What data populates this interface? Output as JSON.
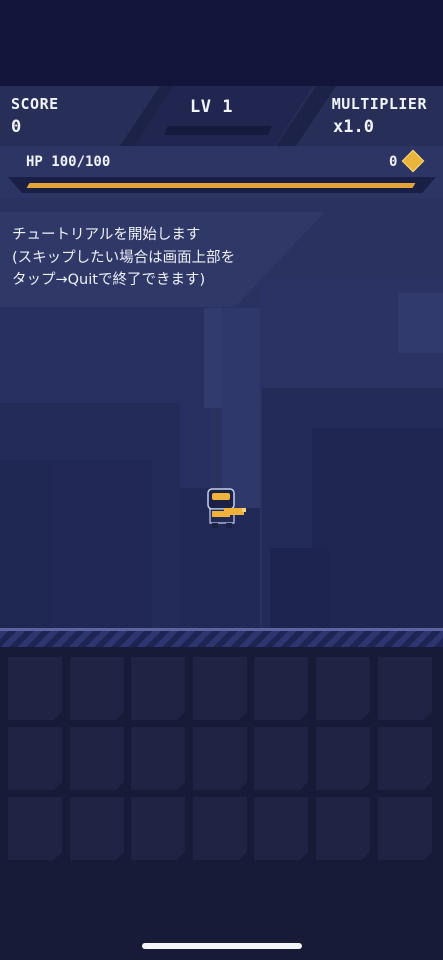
{
  "hud": {
    "score_label": "SCORE",
    "score_value": "0",
    "level_label": "LV 1",
    "multiplier_label": "MULTIPLIER",
    "multiplier_value": "x1.0"
  },
  "status": {
    "hp_text": "HP 100/100",
    "hp_fraction": 1.0,
    "gem_count": "0"
  },
  "tutorial": {
    "message": "チュートリアルを開始します\n(スキップしたい場合は画面上部を\nタップ→Quitで終了できます)"
  },
  "colors": {
    "hp_bar": "#e3a43a",
    "gem": "#e8b43a",
    "player_accent": "#f0b23a"
  },
  "icons": {
    "gem": "diamond-gem-icon",
    "player": "player-character-icon"
  }
}
